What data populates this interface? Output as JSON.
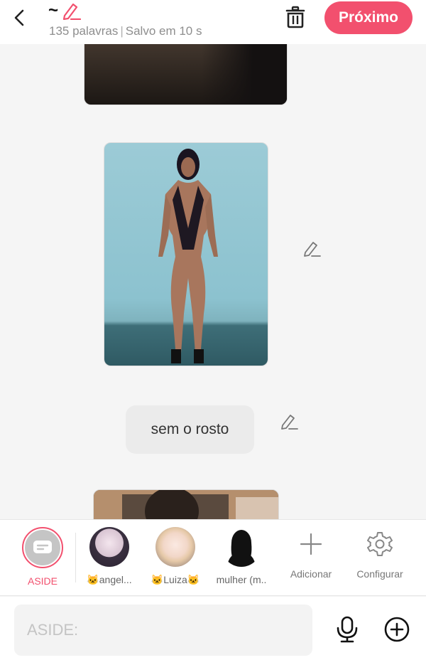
{
  "header": {
    "title": "~",
    "word_count": "135 palavras",
    "save_status": "Salvo em 10 s",
    "next_label": "Próximo"
  },
  "content": {
    "text_bubble": "sem o rosto"
  },
  "characters": [
    {
      "label": "ASIDE",
      "active": true
    },
    {
      "label": "🐱angel..."
    },
    {
      "label": "🐱Luiza🐱"
    },
    {
      "label": "mulher (m.."
    }
  ],
  "tools": {
    "add_label": "Adicionar",
    "settings_label": "Configurar"
  },
  "input": {
    "placeholder": "ASIDE:"
  },
  "colors": {
    "accent": "#f2506e",
    "background": "#f5f5f5"
  },
  "icons": [
    "back-arrow-icon",
    "pencil-icon",
    "trash-icon",
    "plus-icon",
    "gear-icon",
    "microphone-icon",
    "plus-circle-icon",
    "chat-bubble-icon"
  ]
}
